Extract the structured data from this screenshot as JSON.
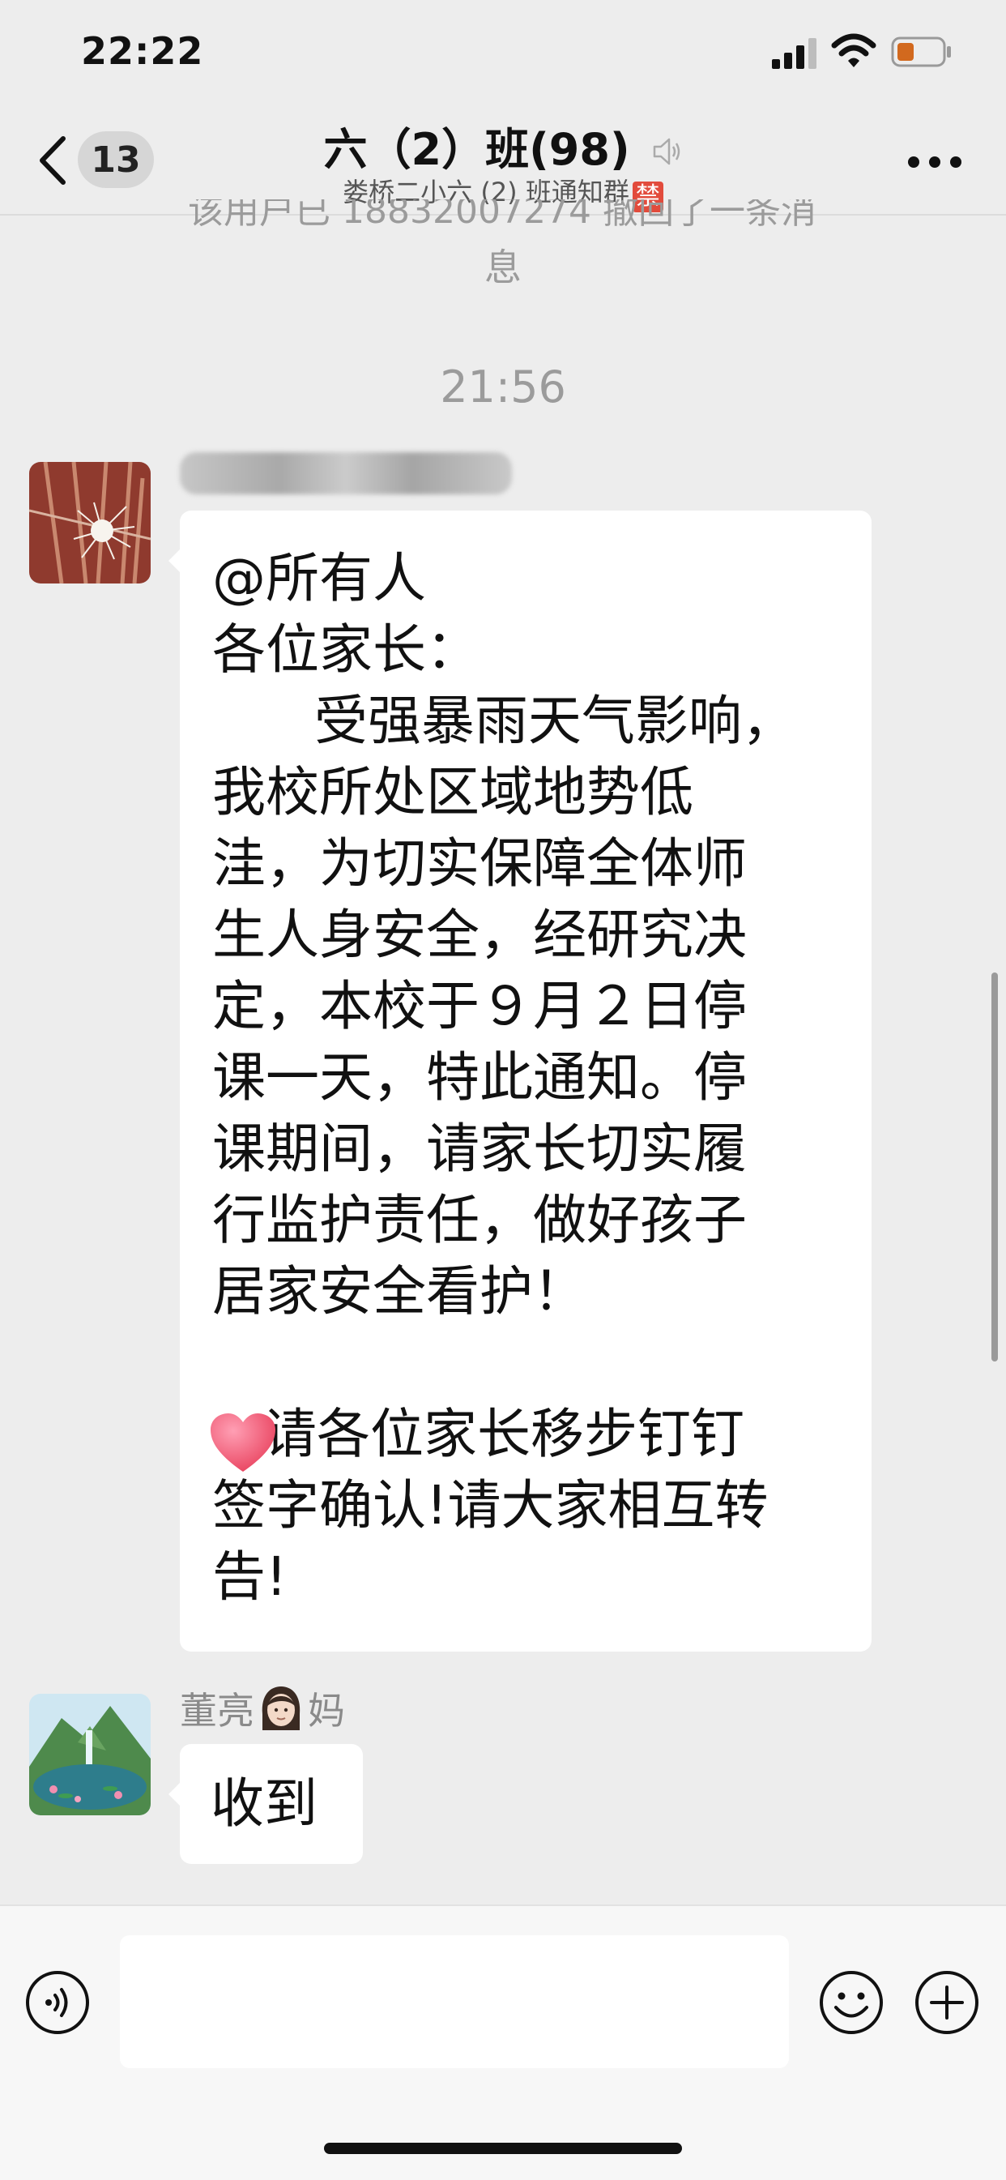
{
  "status_bar": {
    "time": "22:22"
  },
  "nav": {
    "unread_count": "13",
    "title": "六（2）班",
    "member_count": "(98)",
    "subtitle": "娄桥二小六 (2) 班通知群",
    "ban_badge": "禁"
  },
  "recalled_notice": {
    "line1": "该用户已 18832007274 撤回了一条消",
    "line2": "息"
  },
  "timestamp": "21:56",
  "messages": [
    {
      "sender": "",
      "text": "@所有人\n各位家长：\n      受强暴雨天气影响，\n我校所处区域地势低\n洼，为切实保障全体师\n生人身安全，经研究决\n定，本校于９月２日停\n课一天，特此通知。停\n课期间，请家长切实履\n行监护责任，做好孩子\n居家安全看护！\n\n   请各位家长移步钉钉\n签字确认!请大家相互转\n告!"
    },
    {
      "sender_prefix": "董亮",
      "sender_suffix": "妈",
      "text": "收到"
    }
  ],
  "colors": {
    "background": "#ededed",
    "bubble": "#ffffff",
    "ban_badge": "#e24b3c",
    "heart": "#ef5b78"
  },
  "icons": [
    "back-chevron-icon",
    "mute-icon",
    "more-icon",
    "voice-icon",
    "emoji-icon",
    "plus-icon",
    "heart-icon",
    "face-emoji-icon"
  ]
}
